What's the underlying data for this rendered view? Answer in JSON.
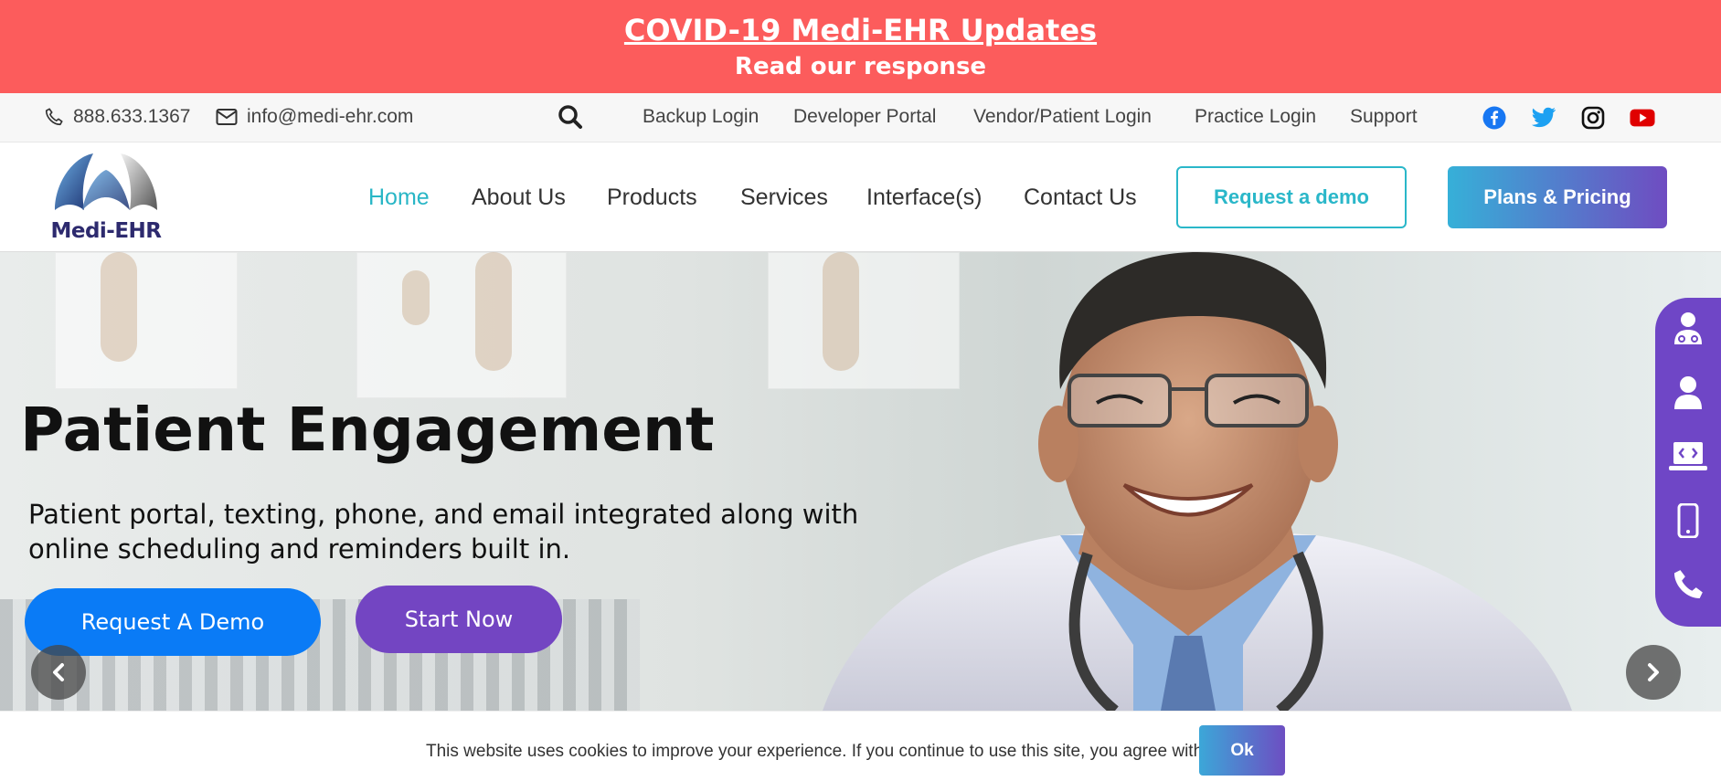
{
  "banner": {
    "title": "COVID-19 Medi-EHR Updates",
    "subtitle": "Read our response",
    "background_color": "#fc5c5c"
  },
  "utility_bar": {
    "phone": "888.633.1367",
    "phone_icon": "phone-icon",
    "email": "info@medi-ehr.com",
    "email_icon": "envelope-icon",
    "search_icon": "search-icon",
    "links": [
      "Backup Login",
      "Developer Portal",
      "Vendor/Patient Login",
      "Practice Login",
      "Support"
    ],
    "social_icons": [
      "facebook-icon",
      "twitter-icon",
      "instagram-icon",
      "youtube-icon"
    ]
  },
  "nav": {
    "logo_text": "Medi-EHR",
    "items": [
      "Home",
      "About Us",
      "Products",
      "Services",
      "Interface(s)",
      "Contact Us"
    ],
    "active_item": "Home",
    "request_demo_label": "Request a demo",
    "plans_label": "Plans & Pricing",
    "accent_color": "#29b6c6"
  },
  "hero": {
    "title": "Patient Engagement",
    "description": "Patient portal, texting, phone, and email integrated along with online scheduling and reminders built in.",
    "demo_button": "Request A Demo",
    "start_button": "Start Now",
    "demo_color": "#0a7bf6",
    "start_color": "#7345c2"
  },
  "side_bar": {
    "icons": [
      "doctor-icon",
      "user-icon",
      "laptop-code-icon",
      "mobile-icon",
      "phone-icon"
    ],
    "color": "#6f46c6"
  },
  "cookie": {
    "text": "This website uses cookies to improve your experience. If you continue to use this site, you agree with it.",
    "ok_label": "Ok"
  }
}
